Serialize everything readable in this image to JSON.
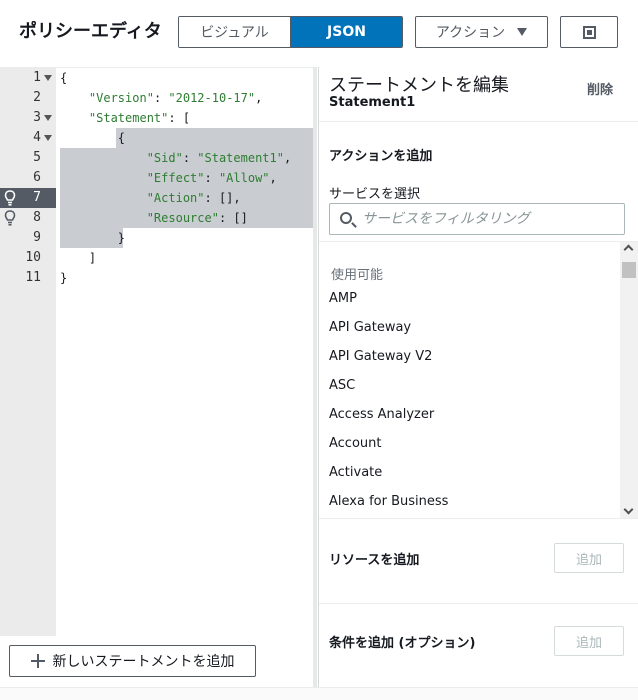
{
  "header": {
    "title": "ポリシーエディタ",
    "tabs": [
      {
        "label": "ビジュアル",
        "active": false
      },
      {
        "label": "JSON",
        "active": true
      }
    ],
    "actions_label": "アクション",
    "accent_color": "#0073bb"
  },
  "editor": {
    "line_numbers": [
      "1",
      "2",
      "3",
      "4",
      "5",
      "6",
      "7",
      "8",
      "9",
      "10",
      "11"
    ],
    "active_line": "7",
    "lines": [
      {
        "indent": "",
        "text": "{"
      },
      {
        "indent": "    ",
        "key": "\"Version\"",
        "sep": ": ",
        "value": "\"2012-10-17\"",
        "end": ","
      },
      {
        "indent": "    ",
        "key": "\"Statement\"",
        "sep": ": ",
        "value": "",
        "end": "["
      },
      {
        "indent": "        ",
        "text": "{"
      },
      {
        "indent": "            ",
        "key": "\"Sid\"",
        "sep": ": ",
        "value": "\"Statement1\"",
        "end": ","
      },
      {
        "indent": "            ",
        "key": "\"Effect\"",
        "sep": ": ",
        "value": "\"Allow\"",
        "end": ","
      },
      {
        "indent": "            ",
        "key": "\"Action\"",
        "sep": ": ",
        "value": "",
        "end": "[],"
      },
      {
        "indent": "            ",
        "key": "\"Resource\"",
        "sep": ": ",
        "value": "",
        "end": "[]"
      },
      {
        "indent": "        ",
        "text": "}"
      },
      {
        "indent": "    ",
        "text": "]"
      },
      {
        "indent": "",
        "text": "}"
      }
    ],
    "new_statement_label": "新しいステートメントを追加"
  },
  "panel": {
    "title": "ステートメントを編集",
    "statement_name": "Statement1",
    "delete_label": "削除",
    "add_action_title": "アクションを追加",
    "select_service_label": "サービスを選択",
    "search_placeholder": "サービスをフィルタリング",
    "available_label": "使用可能",
    "services": [
      "AMP",
      "API Gateway",
      "API Gateway V2",
      "ASC",
      "Access Analyzer",
      "Account",
      "Activate",
      "Alexa for Business"
    ],
    "add_resource_title": "リソースを追加",
    "add_condition_title": "条件を追加 (オプション)",
    "add_label": "追加"
  }
}
